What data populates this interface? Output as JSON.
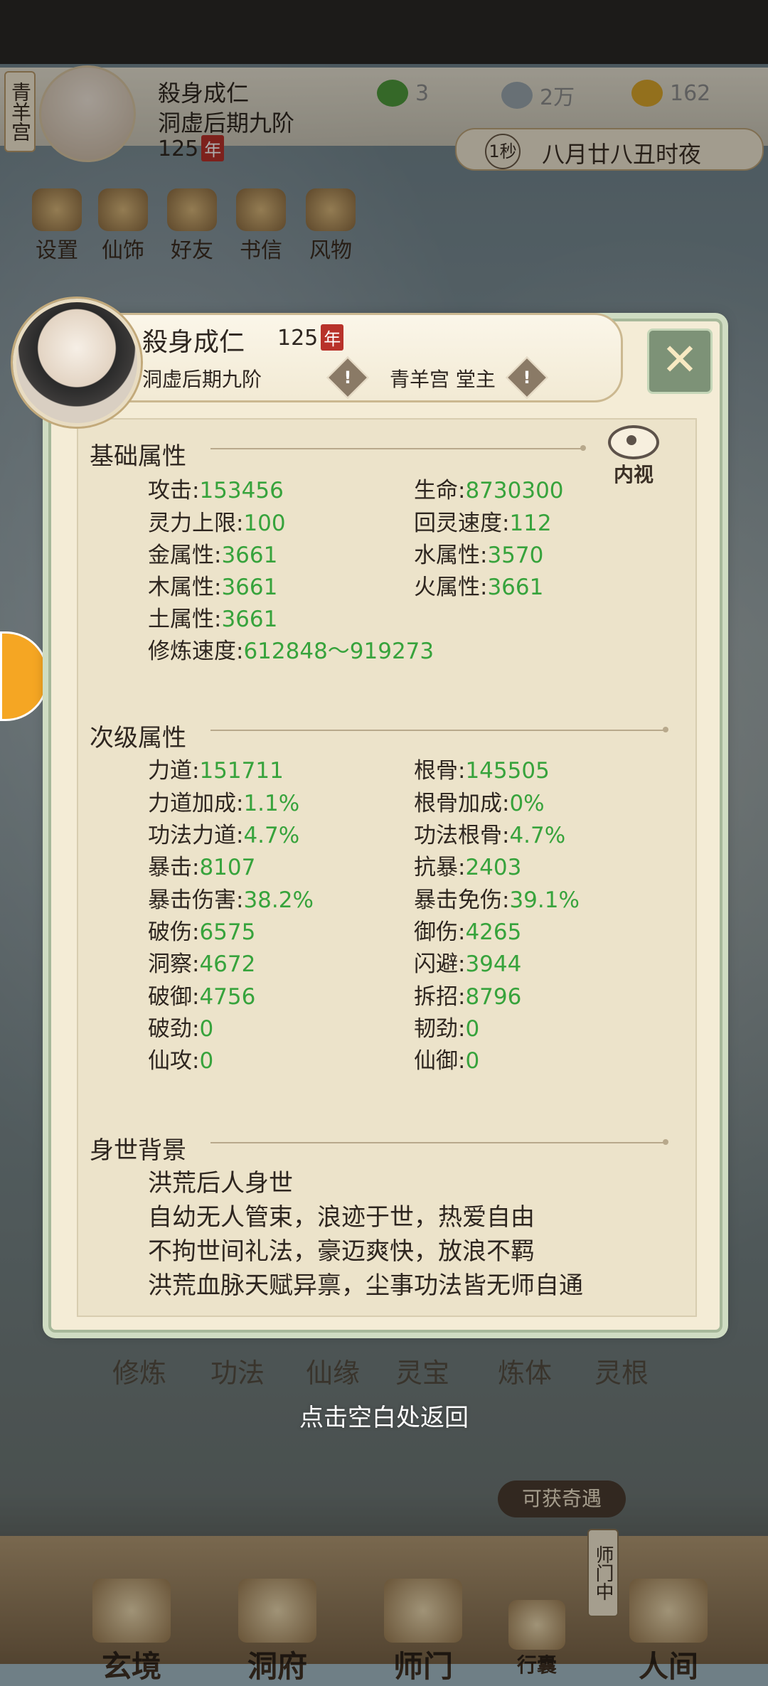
{
  "hud": {
    "sect_tab": "青羊宫",
    "name": "殺身成仁",
    "rank": "洞虚后期九阶",
    "age": "125",
    "age_unit": "年",
    "resources": [
      {
        "icon": "leaf-icon",
        "value": "3"
      },
      {
        "icon": "coin-icon",
        "value": "2万"
      },
      {
        "icon": "ingot-icon",
        "value": "162"
      }
    ],
    "time_speed": "1秒",
    "time_text": "八月廿八丑时夜"
  },
  "quick_menu": [
    "设置",
    "仙饰",
    "好友",
    "书信",
    "风物"
  ],
  "profile": {
    "name": "殺身成仁",
    "age": "125",
    "age_unit": "年",
    "rank": "洞虚后期九阶",
    "sect_role": "青羊宫 堂主",
    "inner_view": "内视",
    "close": "✕"
  },
  "basic_attributes": {
    "title": "基础属性",
    "items": [
      {
        "label": "攻击",
        "value": "153456"
      },
      {
        "label": "生命",
        "value": "8730300"
      },
      {
        "label": "灵力上限",
        "value": "100"
      },
      {
        "label": "回灵速度",
        "value": "112"
      },
      {
        "label": "金属性",
        "value": "3661"
      },
      {
        "label": "水属性",
        "value": "3570"
      },
      {
        "label": "木属性",
        "value": "3661"
      },
      {
        "label": "火属性",
        "value": "3661"
      },
      {
        "label": "土属性",
        "value": "3661"
      },
      {
        "label": "修炼速度",
        "value": "612848～919273"
      }
    ]
  },
  "secondary_attributes": {
    "title": "次级属性",
    "items": [
      {
        "label": "力道",
        "value": "151711"
      },
      {
        "label": "根骨",
        "value": "145505"
      },
      {
        "label": "力道加成",
        "value": "1.1%"
      },
      {
        "label": "根骨加成",
        "value": "0%"
      },
      {
        "label": "功法力道",
        "value": "4.7%"
      },
      {
        "label": "功法根骨",
        "value": "4.7%"
      },
      {
        "label": "暴击",
        "value": "8107"
      },
      {
        "label": "抗暴",
        "value": "2403"
      },
      {
        "label": "暴击伤害",
        "value": "38.2%"
      },
      {
        "label": "暴击免伤",
        "value": "39.1%"
      },
      {
        "label": "破伤",
        "value": "6575"
      },
      {
        "label": "御伤",
        "value": "4265"
      },
      {
        "label": "洞察",
        "value": "4672"
      },
      {
        "label": "闪避",
        "value": "3944"
      },
      {
        "label": "破御",
        "value": "4756"
      },
      {
        "label": "拆招",
        "value": "8796"
      },
      {
        "label": "破劲",
        "value": "0"
      },
      {
        "label": "韧劲",
        "value": "0"
      },
      {
        "label": "仙攻",
        "value": "0"
      },
      {
        "label": "仙御",
        "value": "0"
      }
    ]
  },
  "background": {
    "title": "身世背景",
    "lines": [
      "洪荒后人身世",
      "自幼无人管束，浪迹于世，热爱自由",
      "不拘世间礼法，豪迈爽快，放浪不羁",
      "洪荒血脉天赋异禀，尘事功法皆无师自通"
    ]
  },
  "lower_menu": [
    "修炼",
    "功法",
    "仙缘",
    "灵宝",
    "炼体",
    "灵根"
  ],
  "tap_return": "点击空白处返回",
  "opportunity": "可获奇遇",
  "bottom_nav": [
    "玄境",
    "洞府",
    "师门",
    "行囊",
    "人间"
  ],
  "sect_side_label": "师门中"
}
